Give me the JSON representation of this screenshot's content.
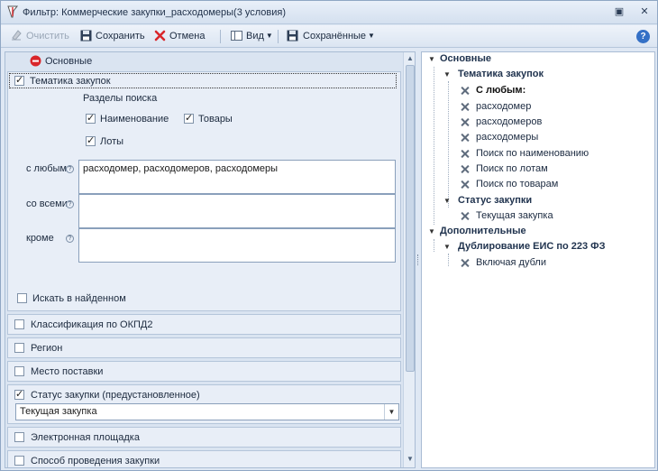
{
  "window": {
    "title": "Фильтр: Коммерческие закупки_расходомеры(3 условия)",
    "restore_glyph": "▣",
    "close_glyph": "✕"
  },
  "toolbar": {
    "clear_label": "Очистить",
    "save_label": "Сохранить",
    "cancel_label": "Отмена",
    "view_label": "Вид",
    "saved_label": "Сохранённые",
    "help_glyph": "?"
  },
  "left": {
    "section_label": "Основные",
    "subject": {
      "label": "Тематика закупок",
      "checked": true,
      "search_sections_label": "Разделы поиска",
      "options": [
        {
          "label": "Наименование",
          "checked": true
        },
        {
          "label": "Товары",
          "checked": true
        },
        {
          "label": "Лоты",
          "checked": true
        }
      ],
      "with_any_label": "с любым",
      "with_any_value": "расходомер, расходомеров, расходомеры",
      "with_all_label": "со всеми",
      "with_all_value": "",
      "except_label": "кроме",
      "except_value": "",
      "search_in_found_label": "Искать в найденном",
      "search_in_found_checked": false,
      "help_glyph": "?"
    },
    "groups": {
      "okpd2": "Классификация по ОКПД2",
      "region": "Регион",
      "delivery": "Место поставки",
      "status": "Статус закупки (предустановленное)",
      "status_value": "Текущая закупка",
      "platform": "Электронная площадка",
      "method": "Способ проведения закупки"
    }
  },
  "tree": {
    "basic": "Основные",
    "subject": "Тематика закупок",
    "with_any": "С любым:",
    "terms": [
      "расходомер",
      "расходомеров",
      "расходомеры",
      "Поиск по наименованию",
      "Поиск по лотам",
      "Поиск по товарам"
    ],
    "status": "Статус закупки",
    "status_value": "Текущая закупка",
    "additional": "Дополнительные",
    "dup": "Дублирование ЕИС по 223 ФЗ",
    "dup_value": "Включая дубли"
  },
  "colors": {
    "accent": "#21344f",
    "panel": "#dae4f1",
    "red": "#d9262b"
  }
}
